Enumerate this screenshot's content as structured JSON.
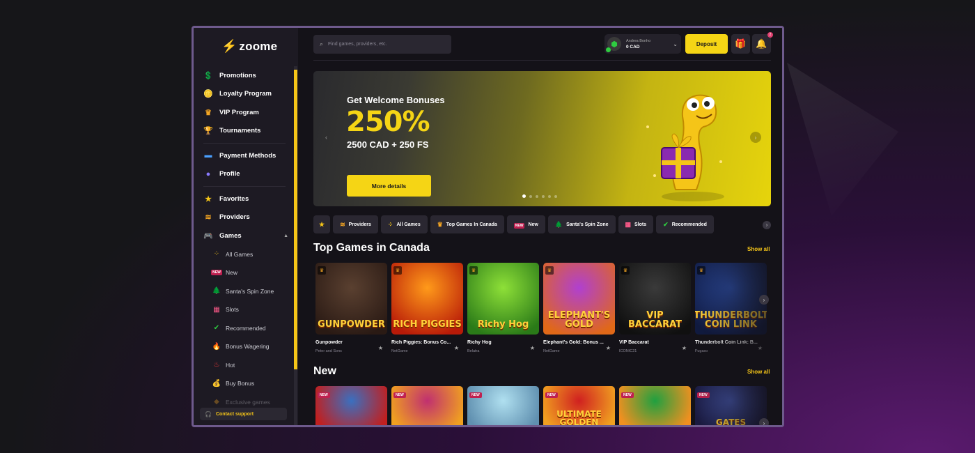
{
  "brand": {
    "logo": "zoome",
    "accent": "#f5c518"
  },
  "sidebar": {
    "main_items": [
      {
        "label": "Promotions",
        "icon": "dollar-icon"
      },
      {
        "label": "Loyalty Program",
        "icon": "loyalty-icon"
      },
      {
        "label": "VIP Program",
        "icon": "crown-icon"
      },
      {
        "label": "Tournaments",
        "icon": "trophy-icon"
      }
    ],
    "account_items": [
      {
        "label": "Payment Methods",
        "icon": "card-icon"
      },
      {
        "label": "Profile",
        "icon": "user-icon"
      }
    ],
    "game_items": [
      {
        "label": "Favorites",
        "icon": "star-icon"
      },
      {
        "label": "Providers",
        "icon": "providers-icon"
      },
      {
        "label": "Games",
        "icon": "gamepad-icon"
      }
    ],
    "sub_items": [
      {
        "label": "All Games",
        "icon": "grid-icon"
      },
      {
        "label": "New",
        "icon": "new-icon"
      },
      {
        "label": "Santa's Spin Zone",
        "icon": "tree-icon"
      },
      {
        "label": "Slots",
        "icon": "slots-icon"
      },
      {
        "label": "Recommended",
        "icon": "thumbsup-icon"
      },
      {
        "label": "Bonus Wagering",
        "icon": "fire-icon"
      },
      {
        "label": "Hot",
        "icon": "hot-icon"
      },
      {
        "label": "Buy Bonus",
        "icon": "moneybag-icon"
      },
      {
        "label": "Exclusive games",
        "icon": "exclusive-icon"
      }
    ],
    "support_label": "Contact support"
  },
  "header": {
    "search_placeholder": "Find games, providers, etc.",
    "account_name": "Andrea Bonho",
    "account_balance": "0 CAD",
    "deposit_label": "Deposit",
    "notification_count": "2"
  },
  "banner": {
    "subtitle": "Get Welcome Bonuses",
    "percent": "250%",
    "amount": "2500 CAD + 250 FS",
    "button_label": "More details",
    "slide_count": 6,
    "active_slide": 1
  },
  "tabs": [
    {
      "label": "",
      "icon": "star-icon"
    },
    {
      "label": "Providers",
      "icon": "providers-icon"
    },
    {
      "label": "All Games",
      "icon": "grid-icon"
    },
    {
      "label": "Top Games In Canada",
      "icon": "crown-icon"
    },
    {
      "label": "New",
      "icon": "new-icon"
    },
    {
      "label": "Santa's Spin Zone",
      "icon": "tree-icon"
    },
    {
      "label": "Slots",
      "icon": "slots-icon"
    },
    {
      "label": "Recommended",
      "icon": "thumbsup-icon"
    }
  ],
  "sections": {
    "top": {
      "title": "Top Games in Canada",
      "show_all": "Show all",
      "games": [
        {
          "title": "Gunpowder",
          "provider": "Peter and Sons",
          "art": "GUNPOWDER",
          "colors": [
            "#5a4030",
            "#2a1a14"
          ]
        },
        {
          "title": "Rich Piggies: Bonus Co...",
          "provider": "NetGame",
          "art": "RICH PIGGIES",
          "colors": [
            "#ff9a1a",
            "#b81a08"
          ]
        },
        {
          "title": "Richy Hog",
          "provider": "Belatra",
          "art": "Richy Hog",
          "colors": [
            "#8ee038",
            "#2a7a18"
          ]
        },
        {
          "title": "Elephant's Gold: Bonus ...",
          "provider": "NetGame",
          "art": "ELEPHANT'S GOLD",
          "colors": [
            "#b040d0",
            "#e06818"
          ]
        },
        {
          "title": "VIP Baccarat",
          "provider": "ICONIC21",
          "art": "VIP BACCARAT",
          "colors": [
            "#3a3a3a",
            "#101010"
          ]
        },
        {
          "title": "Thunderbolt Coin Link: B...",
          "provider": "Fugaso",
          "art": "THUNDERBOLT COIN LINK",
          "colors": [
            "#2a4aa0",
            "#101a40"
          ]
        }
      ]
    },
    "new": {
      "title": "New",
      "show_all": "Show all",
      "badge": "NEW",
      "games": [
        {
          "art": "",
          "colors": [
            "#3a70c0",
            "#c02020"
          ]
        },
        {
          "art": "",
          "colors": [
            "#c03070",
            "#f0a020"
          ]
        },
        {
          "art": "",
          "colors": [
            "#b0e0f0",
            "#6090b0"
          ]
        },
        {
          "art": "ULTIMATE GOLDEN",
          "colors": [
            "#d02020",
            "#f0a020"
          ]
        },
        {
          "art": "",
          "colors": [
            "#20a040",
            "#f09020"
          ]
        },
        {
          "art": "GATES",
          "colors": [
            "#4050a0",
            "#1a1a40"
          ]
        }
      ]
    }
  }
}
